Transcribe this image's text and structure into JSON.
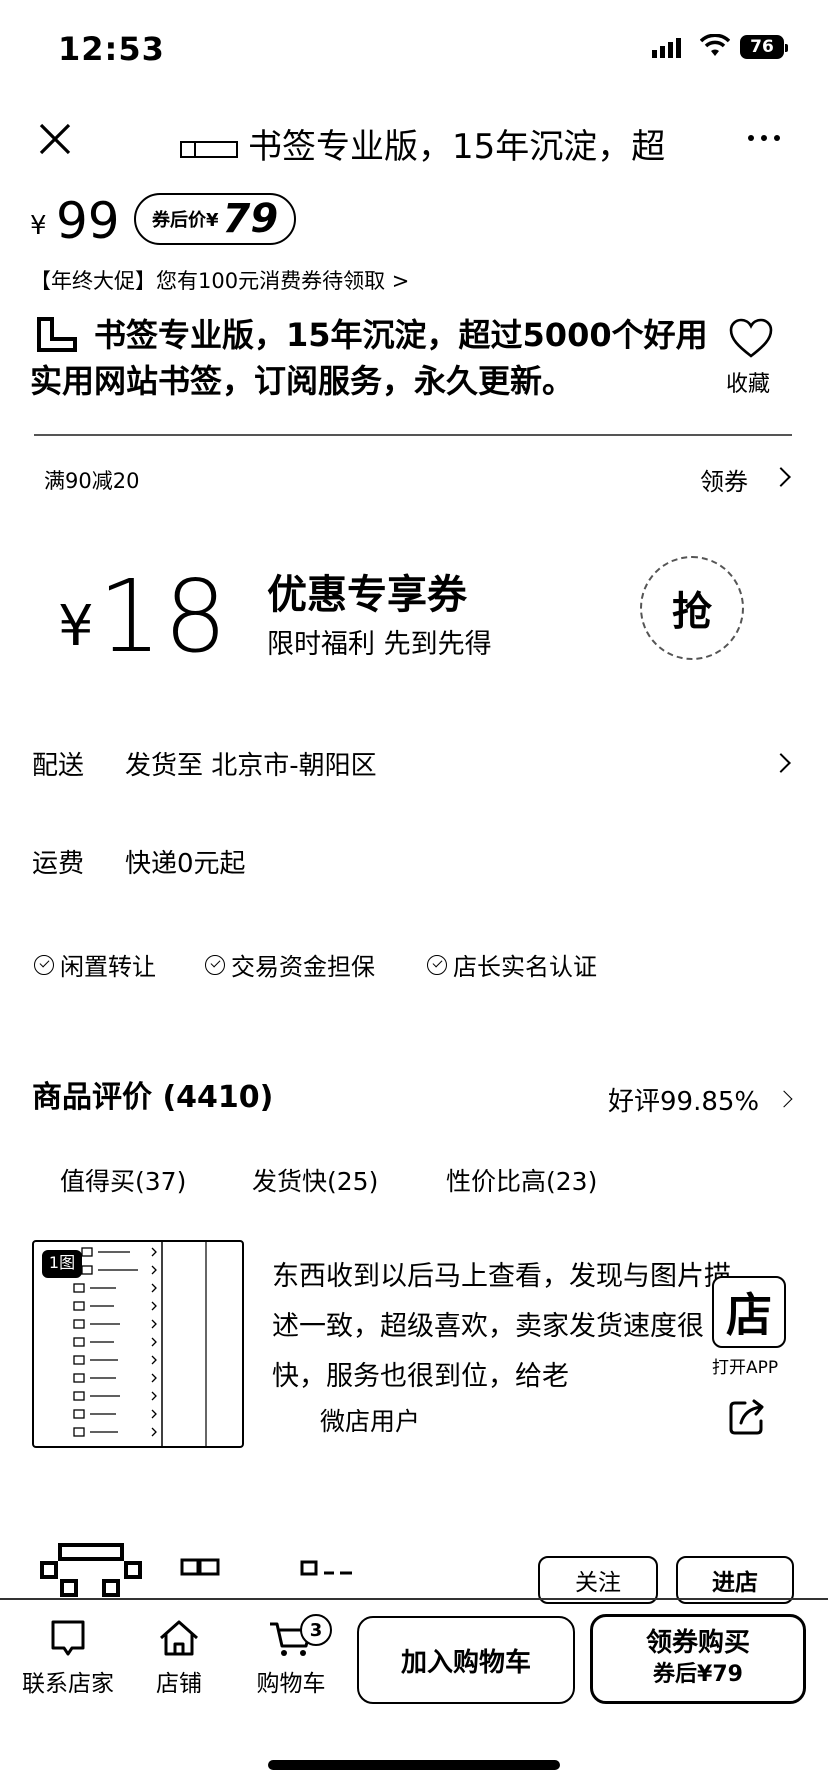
{
  "status": {
    "time": "12:53",
    "battery": "76"
  },
  "nav": {
    "title": "书签专业版，15年沉淀，超"
  },
  "price": {
    "currency": "¥",
    "value": "99",
    "coupon_label": "券后价¥",
    "coupon_value": "79",
    "promo": "【年终大促】您有100元消费券待领取 >"
  },
  "product": {
    "title": "书签专业版，15年沉淀，超过5000个好用实用网站书签，订阅服务，永久更新。",
    "favorite_label": "收藏"
  },
  "coupon": {
    "rule": "满90减20",
    "get_label": "领券",
    "currency": "¥",
    "amount": "18",
    "title": "优惠专享券",
    "subtitle": "限时福利 先到先得",
    "grab_label": "抢"
  },
  "delivery": {
    "label": "配送",
    "value": "发货至  北京市-朝阳区",
    "freight_label": "运费",
    "freight_value": "快递0元起"
  },
  "guarantees": [
    "闲置转让",
    "交易资金担保",
    "店长实名认证"
  ],
  "reviews": {
    "title": "商品评价 (4410)",
    "rate": "好评99.85%",
    "tags": [
      "值得买(37)",
      "发货快(25)",
      "性价比高(23)"
    ],
    "image_badge": "1图",
    "text": "东西收到以后马上查看，发现与图片描述一致，超级喜欢，卖家发货速度很快，服务也很到位，给老",
    "user": "微店用户"
  },
  "floating": {
    "store_char": "店",
    "open_app": "打开APP"
  },
  "shop": {
    "follow_label": "关注",
    "enter_label": "进店"
  },
  "bottom": {
    "contact": "联系店家",
    "store": "店铺",
    "cart": "购物车",
    "cart_count": "3",
    "add_to_cart": "加入购物车",
    "buy_main": "领券购买",
    "buy_sub": "券后¥79"
  }
}
